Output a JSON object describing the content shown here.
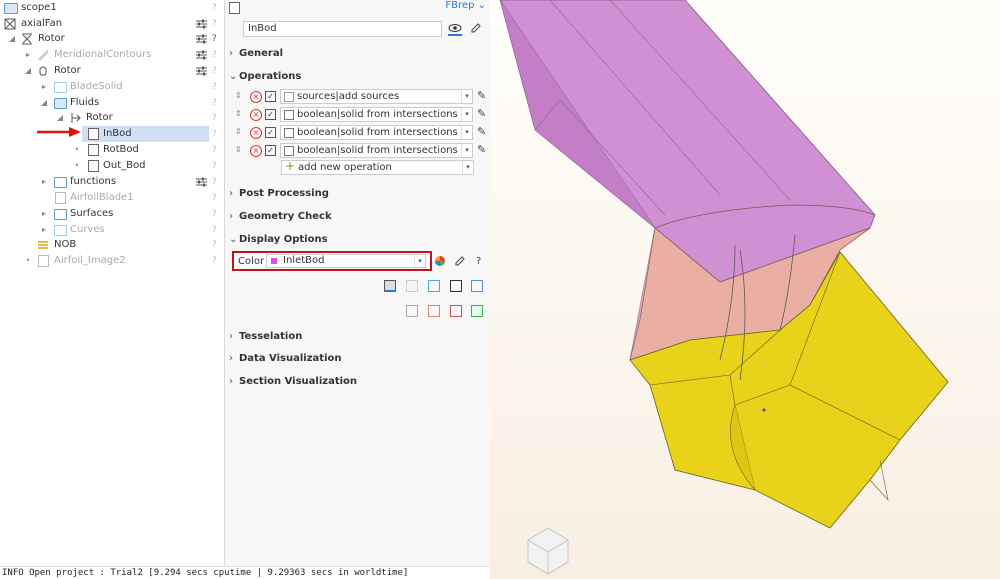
{
  "tree": {
    "items": [
      {
        "label": "scope1",
        "icon": "scope-folder-icon"
      },
      {
        "label": "axialFan",
        "icon": "project-icon"
      },
      {
        "label": "Rotor",
        "icon": "rotor-icon"
      },
      {
        "label": "MeridionalContours",
        "icon": "contour-icon"
      },
      {
        "label": "Rotor",
        "icon": "bell-icon"
      },
      {
        "label": "BladeSolid",
        "icon": "folder-icon"
      },
      {
        "label": "Fluids",
        "icon": "folder-icon"
      },
      {
        "label": "Rotor",
        "icon": "import-icon"
      },
      {
        "label": "InBod",
        "icon": "body-icon"
      },
      {
        "label": "RotBod",
        "icon": "body-icon"
      },
      {
        "label": "Out_Bod",
        "icon": "body-icon"
      },
      {
        "label": "functions",
        "icon": "folder-icon"
      },
      {
        "label": "AirfoilBlade1",
        "icon": "doc-icon"
      },
      {
        "label": "Surfaces",
        "icon": "folder-icon"
      },
      {
        "label": "Curves",
        "icon": "folder-icon"
      },
      {
        "label": "NOB",
        "icon": "nob-icon"
      },
      {
        "label": "Airfoil_Image2",
        "icon": "doc-icon"
      }
    ],
    "help": "?"
  },
  "panel": {
    "type_selector": "FBrep",
    "name": "InBod",
    "sections": {
      "general": "General",
      "operations": "Operations",
      "post": "Post Processing",
      "geometry": "Geometry Check",
      "display": "Display Options",
      "tesselation": "Tesselation",
      "dataviz": "Data Visualization",
      "sectionviz": "Section Visualization"
    },
    "operations": [
      {
        "label": "sources|add sources"
      },
      {
        "label": "boolean|solid from intersections"
      },
      {
        "label": "boolean|solid from intersections"
      },
      {
        "label": "boolean|solid from intersections"
      }
    ],
    "add_operation": "add new operation",
    "color_label": "Color",
    "color_value": "InletBod",
    "color_swatch": "#e04de0",
    "help": "?"
  },
  "status": {
    "text": "INFO Open project : Trial2 [9.294 secs cputime | 9.29363 secs in worldtime]"
  },
  "colors": {
    "accent": "#2b7bd0",
    "highlight": "#c0141c",
    "selection": "#cfe0f3",
    "pipe": "#d48ad4",
    "hub": "#e8d21a"
  }
}
